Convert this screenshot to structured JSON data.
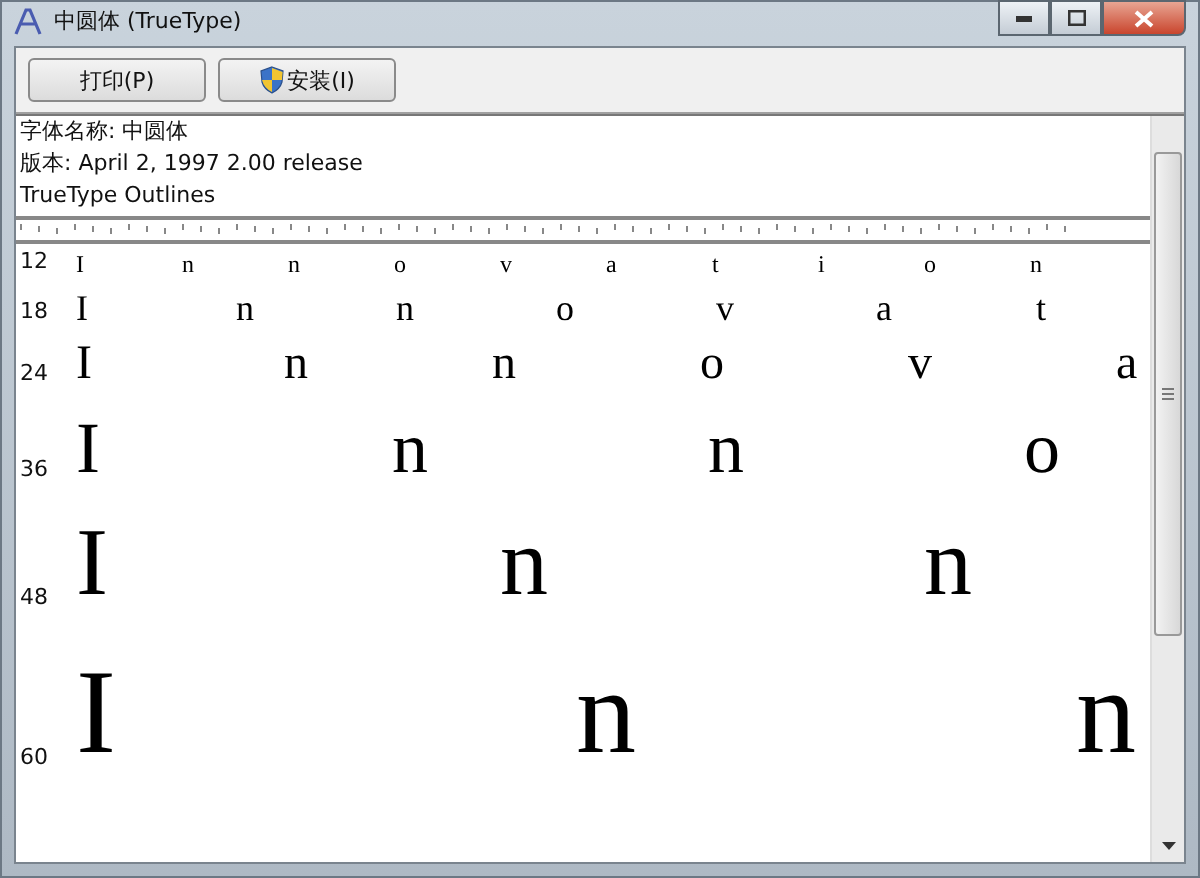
{
  "window": {
    "title": "中圆体 (TrueType)"
  },
  "toolbar": {
    "buttons": [
      {
        "label": "打印(P)",
        "kind": "plain"
      },
      {
        "label": "安装(I)",
        "kind": "shield"
      }
    ]
  },
  "info": [
    "字体名称: 中圆体",
    "版本: April 2, 1997 2.00 release",
    "TrueType Outlines"
  ],
  "samples": [
    {
      "size": "12",
      "glyphs": [
        "I",
        "n",
        "n",
        "o",
        "v",
        "a",
        "t",
        "i",
        "o",
        "n"
      ]
    },
    {
      "size": "18",
      "glyphs": [
        "I",
        "n",
        "n",
        "o",
        "v",
        "a",
        "t"
      ]
    },
    {
      "size": "24",
      "glyphs": [
        "I",
        "n",
        "n",
        "o",
        "v",
        "a"
      ]
    },
    {
      "size": "36",
      "glyphs": [
        "I",
        "n",
        "n",
        "o"
      ]
    },
    {
      "size": "48",
      "glyphs": [
        "I",
        "n",
        "n"
      ]
    },
    {
      "size": "60",
      "glyphs": [
        "I",
        "n",
        "n"
      ]
    }
  ]
}
